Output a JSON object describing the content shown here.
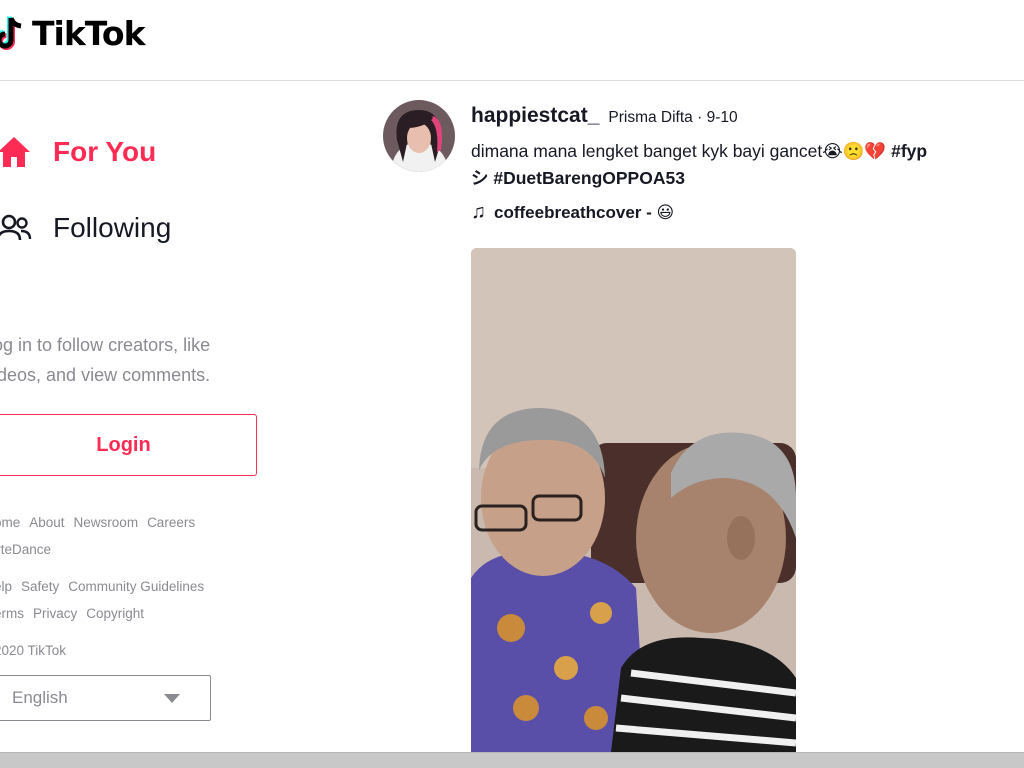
{
  "header": {
    "logo_text": "TikTok"
  },
  "sidebar": {
    "nav": [
      {
        "label": "For You",
        "icon": "home-icon",
        "active": true
      },
      {
        "label": "Following",
        "icon": "users-icon",
        "active": false
      }
    ],
    "login_prompt": "og in to follow creators, like\nideos, and view comments.",
    "login_button": "Login",
    "footer": {
      "line1": [
        "ome",
        "About",
        "Newsroom",
        "Careers"
      ],
      "line2": [
        "yteDance"
      ],
      "line3": [
        "elp",
        "Safety",
        "Community Guidelines"
      ],
      "line4": [
        "erms",
        "Privacy",
        "Copyright"
      ],
      "copyright": "2020 TikTok"
    },
    "language": {
      "selected": "English"
    }
  },
  "post": {
    "username": "happiestcat_",
    "nickname_date": "Prisma Difta · 9-10",
    "caption_text": "dimana mana lengket banget kyk bayi gancet😭🙁💔 ",
    "caption_tag1": "#fyp",
    "caption_line2": "シ #DuetBarengOPPOA53",
    "music_title": "coffeebreathcover - 😃"
  },
  "colors": {
    "accent": "#fe2c55",
    "text": "#161823",
    "muted": "#8a8b91"
  }
}
